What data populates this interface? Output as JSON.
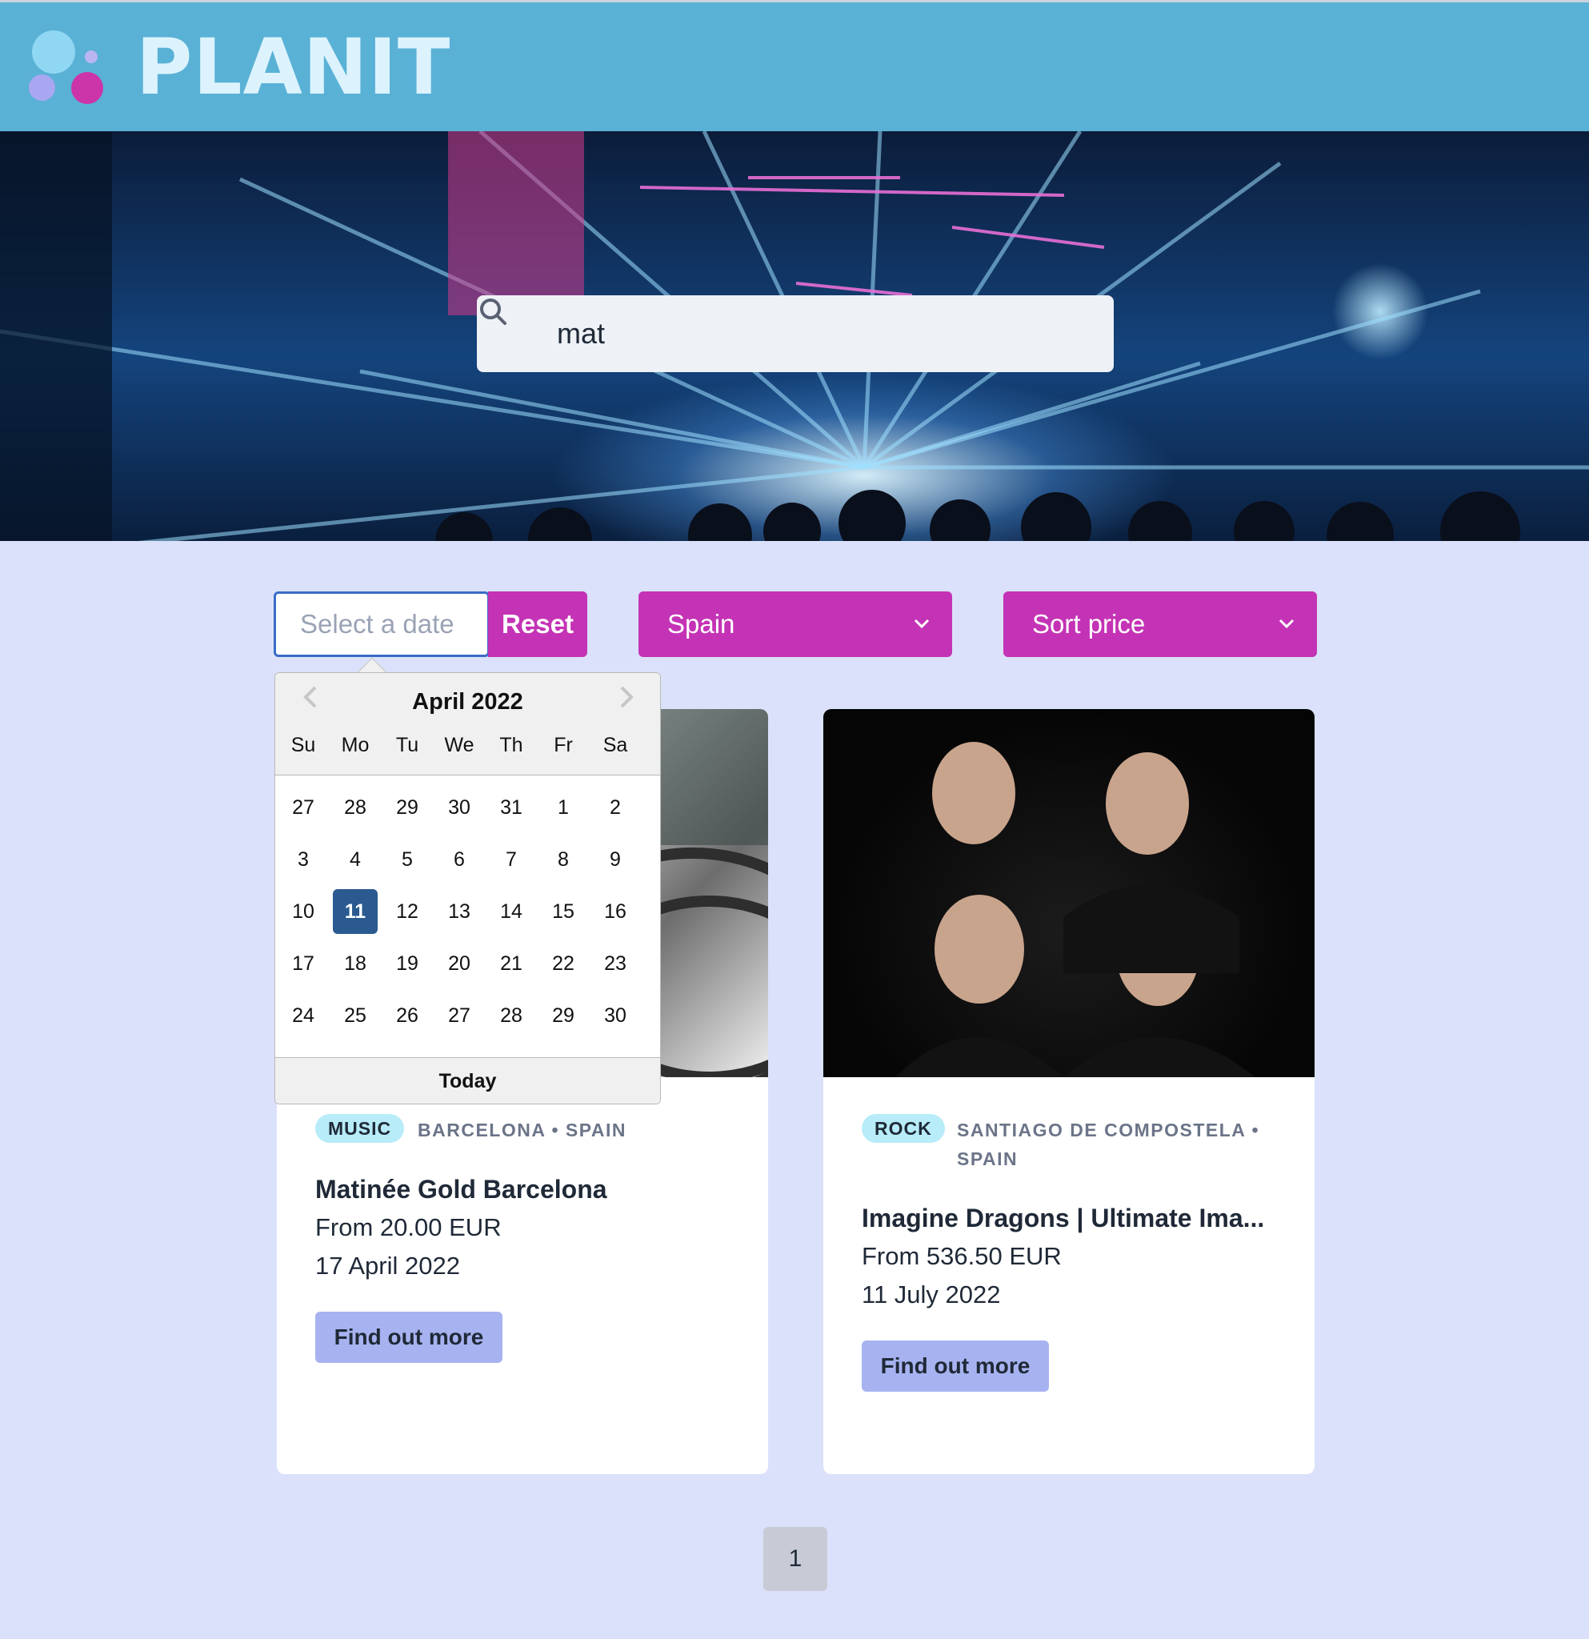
{
  "app": {
    "brand": "PLANIT"
  },
  "search": {
    "value": "mat"
  },
  "filters": {
    "date_placeholder": "Select a date",
    "reset_label": "Reset",
    "country": "Spain",
    "sort": "Sort price"
  },
  "datepicker": {
    "month": "April 2022",
    "day_names": [
      "Su",
      "Mo",
      "Tu",
      "We",
      "Th",
      "Fr",
      "Sa"
    ],
    "weeks": [
      [
        "27",
        "28",
        "29",
        "30",
        "31",
        "1",
        "2"
      ],
      [
        "3",
        "4",
        "5",
        "6",
        "7",
        "8",
        "9"
      ],
      [
        "10",
        "11",
        "12",
        "13",
        "14",
        "15",
        "16"
      ],
      [
        "17",
        "18",
        "19",
        "20",
        "21",
        "22",
        "23"
      ],
      [
        "24",
        "25",
        "26",
        "27",
        "28",
        "29",
        "30"
      ]
    ],
    "selected": "11",
    "today_label": "Today"
  },
  "events": [
    {
      "category": "MUSIC",
      "location": "BARCELONA • SPAIN",
      "title": "Matinée Gold Barcelona",
      "price": "From 20.00 EUR",
      "date": "17 April 2022",
      "button": "Find out more"
    },
    {
      "category": "ROCK",
      "location_line1": "SANTIAGO DE COMPOSTELA •",
      "location_line2": "SPAIN",
      "title": "Imagine Dragons | Ultimate Ima...",
      "price": "From 536.50 EUR",
      "date": "11 July 2022",
      "button": "Find out more"
    }
  ],
  "pagination": {
    "current": "1"
  },
  "colors": {
    "header": "#5ab1d6",
    "accent": "#c433b5",
    "page_bg": "#dbe1fa",
    "button": "#a7b3f0",
    "selected_day": "#2a5a90",
    "badge": "#b7ecf8"
  },
  "icons": [
    "search-icon",
    "chevron-down-icon",
    "chevron-left-icon",
    "chevron-right-icon"
  ]
}
